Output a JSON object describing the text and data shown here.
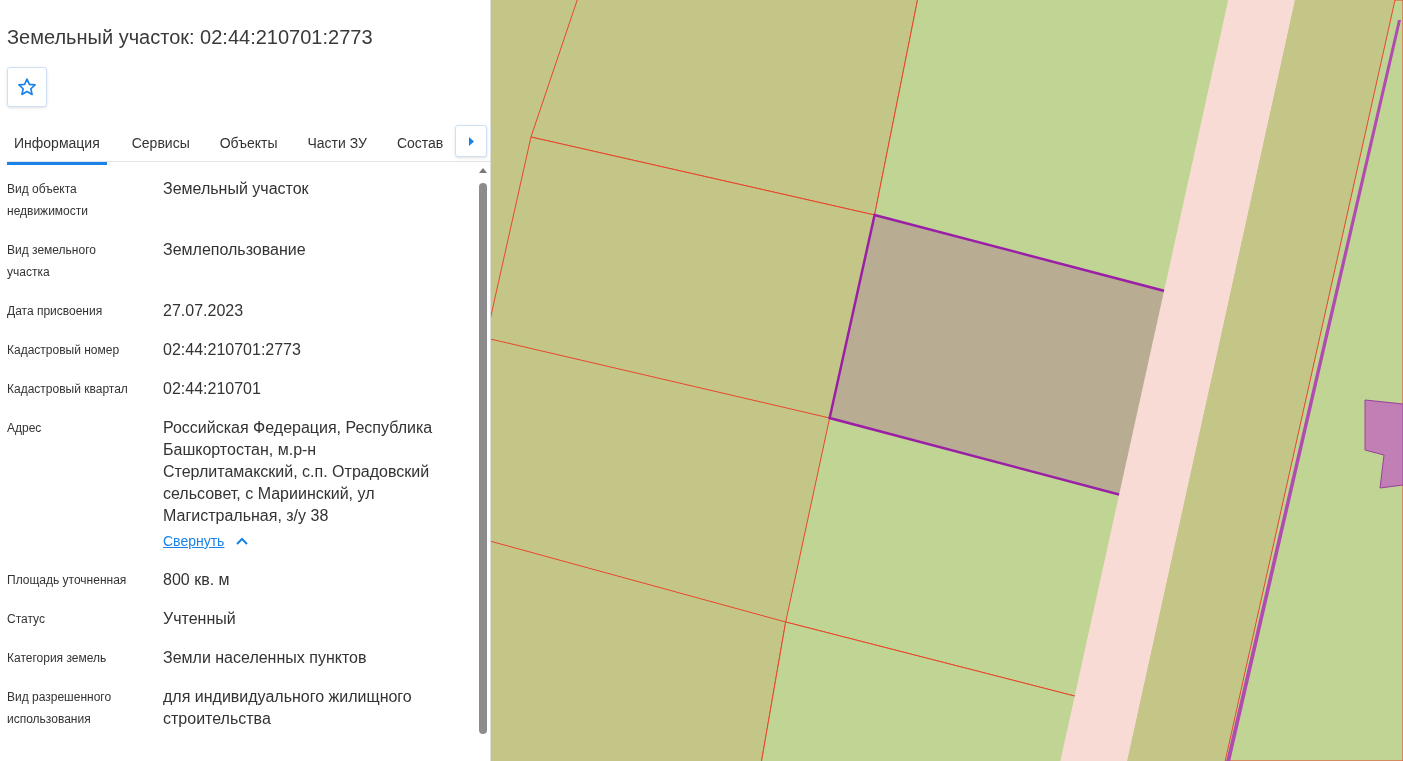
{
  "title": "Земельный участок: 02:44:210701:2773",
  "favorite": {
    "on": false
  },
  "tabs": [
    {
      "label": "Информация",
      "selected": true
    },
    {
      "label": "Сервисы",
      "selected": false
    },
    {
      "label": "Объекты",
      "selected": false
    },
    {
      "label": "Части ЗУ",
      "selected": false
    },
    {
      "label": "Состав",
      "selected": false
    }
  ],
  "properties": [
    {
      "label": "Вид объекта недвижимости",
      "value": "Земельный участок"
    },
    {
      "label": "Вид земельного участка",
      "value": "Землепользование"
    },
    {
      "label": "Дата присвоения",
      "value": "27.07.2023"
    },
    {
      "label": "Кадастровый номер",
      "value": "02:44:210701:2773"
    },
    {
      "label": "Кадастровый квартал",
      "value": "02:44:210701"
    },
    {
      "label": "Адрес",
      "value": "Российская Федерация, Республика Башкортостан, м.р-н Стерлитамакский, с.п. Отрадовский сельсовет, с Мариинский, ул Магистральная, з/у 38",
      "toggle": {
        "label": "Свернуть",
        "expanded": true
      }
    },
    {
      "label": "Площадь уточненная",
      "value": "800 кв. м"
    },
    {
      "label": "Статус",
      "value": "Учтенный"
    },
    {
      "label": "Категория земель",
      "value": "Земли населенных пунктов"
    },
    {
      "label": "Вид разрешенного использования",
      "value": "для индивидуального жилищного строительства"
    }
  ]
}
